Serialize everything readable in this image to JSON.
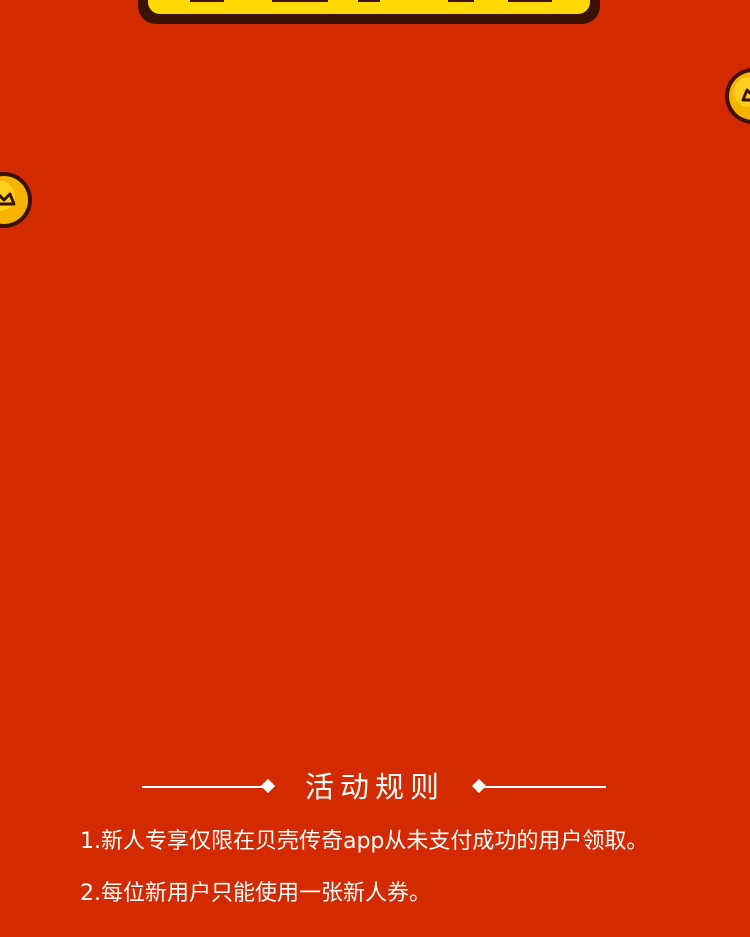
{
  "rules": {
    "title": "活动规则",
    "items": [
      "1.新人专享仅限在贝壳传奇app从未支付成功的用户领取。",
      "2.每位新用户只能使用一张新人券。"
    ]
  },
  "icons": {
    "coin_top_right": "coin-icon",
    "coin_left": "coin-icon",
    "divider_left": "diamond-icon",
    "divider_right": "diamond-icon"
  },
  "colors": {
    "background": "#d42a00",
    "banner_yellow": "#ffd800",
    "banner_outline": "#3a1206",
    "coin_gold": "#f6b400",
    "text": "#ffffff"
  }
}
